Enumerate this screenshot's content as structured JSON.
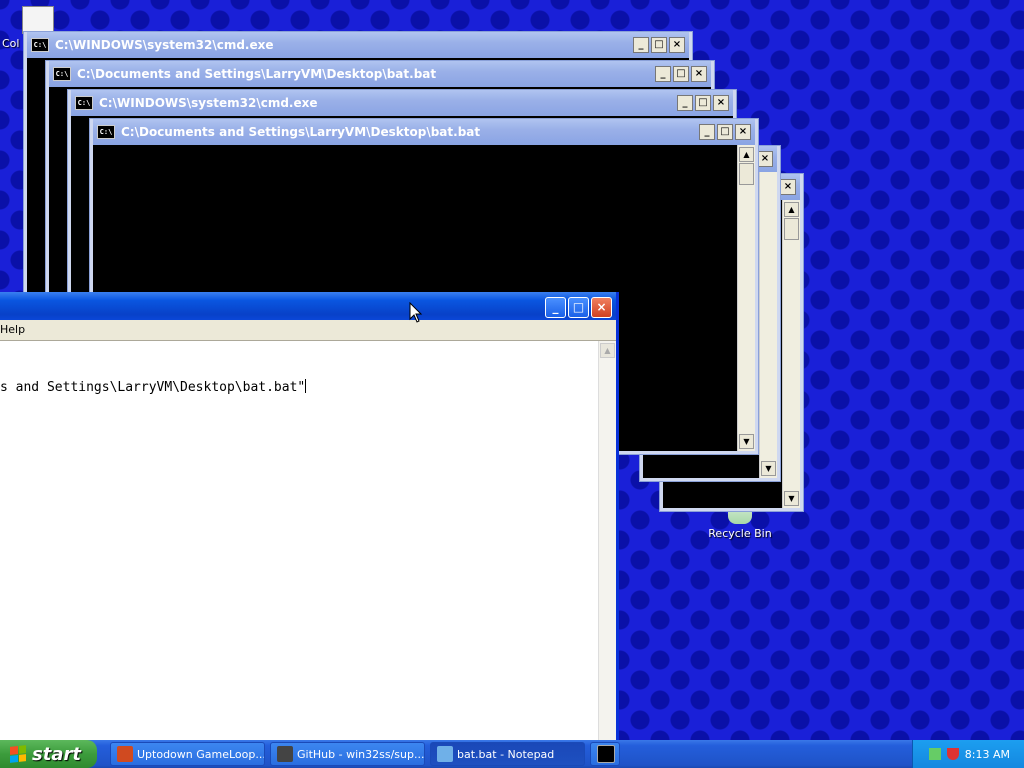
{
  "desktop": {
    "icons": [
      {
        "label": "Col",
        "icon": "certificate-icon"
      },
      {
        "label": "Recycle Bin",
        "icon": "recycle-bin-icon"
      }
    ]
  },
  "windows": [
    {
      "title": "C:\\WINDOWS\\system32\\cmd.exe",
      "icon": "cmd-icon"
    },
    {
      "title": "C:\\Documents and Settings\\LarryVM\\Desktop\\bat.bat",
      "icon": "cmd-icon"
    },
    {
      "title": "C:\\WINDOWS\\system32\\cmd.exe",
      "icon": "cmd-icon"
    },
    {
      "title": "C:\\Documents and Settings\\LarryVM\\Desktop\\bat.bat",
      "icon": "cmd-icon"
    }
  ],
  "cmd_icon_text": "C:\\",
  "notepad": {
    "menu_help": "Help",
    "content": "s and Settings\\LarryVM\\Desktop\\bat.bat\""
  },
  "taskbar": {
    "start_label": "start",
    "tasks": [
      {
        "label": "Uptodown GameLoop...",
        "icon": "gameloop-icon",
        "color": "#d04a20"
      },
      {
        "label": "GitHub - win32ss/sup...",
        "icon": "github-icon",
        "color": "#444444"
      },
      {
        "label": "bat.bat - Notepad",
        "icon": "notepad-icon",
        "color": "#6fb0e8"
      },
      {
        "label": "",
        "icon": "cmd-icon",
        "color": "#000000"
      }
    ],
    "clock": "8:13 AM"
  },
  "colors": {
    "desktop_bg": "#1a20d8",
    "taskbar": "#245edb",
    "start": "#3c9c3c"
  }
}
